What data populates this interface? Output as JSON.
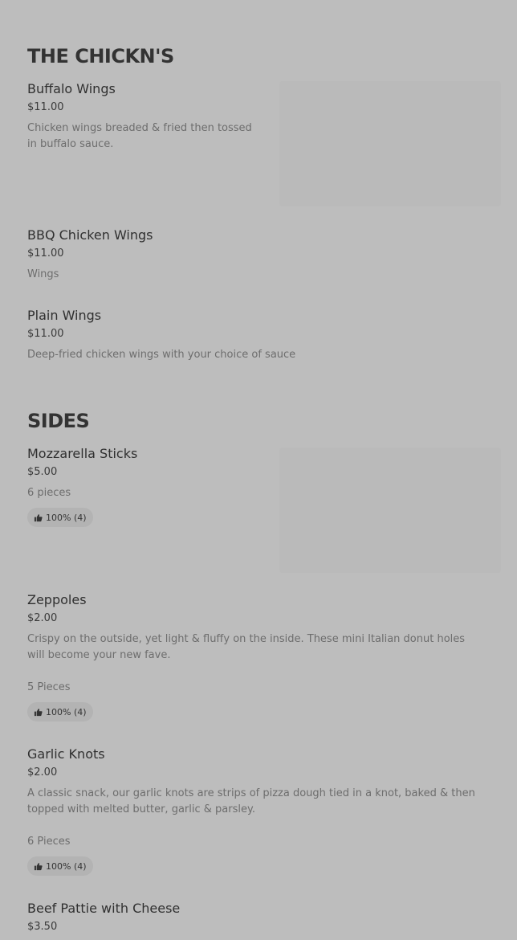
{
  "sections": [
    {
      "title": "THE CHICKN'S",
      "items": [
        {
          "name": "Buffalo Wings",
          "price": "$11.00",
          "description": "Chicken wings breaded & fried then tossed in buffalo sauce."
        },
        {
          "name": "BBQ Chicken Wings",
          "price": "$11.00",
          "description": "Wings"
        },
        {
          "name": "Plain Wings",
          "price": "$11.00",
          "description": "Deep-fried chicken wings with your choice of sauce"
        }
      ]
    },
    {
      "title": "SIDES",
      "items": [
        {
          "name": "Mozzarella Sticks",
          "price": "$5.00",
          "description": "6 pieces",
          "rating": "100% (4)"
        },
        {
          "name": "Zeppoles",
          "price": "$2.00",
          "description": "Crispy on the outside, yet light & fluffy on the inside. These mini Italian donut holes will become your new fave.",
          "extra": "5 Pieces",
          "rating": "100% (4)"
        },
        {
          "name": "Garlic Knots",
          "price": "$2.00",
          "description": "A classic snack, our garlic knots are strips of pizza dough tied in a knot, baked & then topped with melted butter, garlic & parsley.",
          "extra": "6 Pieces",
          "rating": "100% (4)"
        },
        {
          "name": "Beef Pattie with Cheese",
          "price": "$3.50"
        }
      ]
    }
  ],
  "icons": {
    "rating": "thumbs-up-icon"
  }
}
